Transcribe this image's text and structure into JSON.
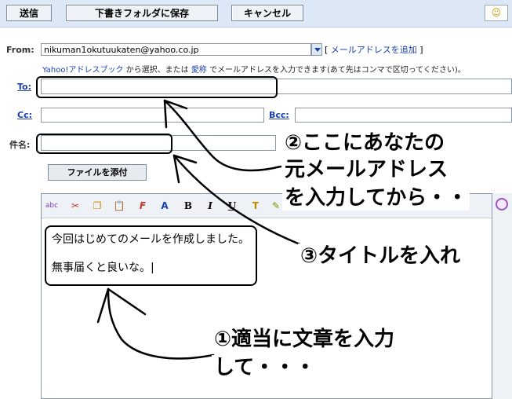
{
  "toolbar": {
    "send_label": "送信",
    "draft_label": "下書きフォルダに保存",
    "cancel_label": "キャンセル"
  },
  "from": {
    "label": "From:",
    "value": "nikuman1okutuukaten@yahoo.co.jp",
    "add_prefix": "[ ",
    "add_link": "メールアドレスを追加",
    "add_suffix": " ]"
  },
  "help": {
    "part1": "Yahoo!アドレスブック",
    "part2": " から選択、または ",
    "part3": "愛称",
    "part4": " でメールアドレスを入力できます(あて先はコンマで区切ってください)。"
  },
  "fields": {
    "to_label": "To:",
    "cc_label": "Cc:",
    "bcc_label": "Bcc:",
    "subject_label": "件名:",
    "to_value": "",
    "cc_value": "",
    "bcc_value": "",
    "subject_value": ""
  },
  "attach_label": "ファイルを添付",
  "editor": {
    "line1": "今回はじめてのメールを作成しました。",
    "line2": "無事届くと良いな。|"
  },
  "annotations": {
    "a2_line1": "②ここにあなたの",
    "a2_line2": "元メールアドレス",
    "a2_line3": "を入力してから・・",
    "a3": "③タイトルを入れ",
    "a1_line1": "①適当に文章を入力",
    "a1_line2": "して・・・"
  },
  "editor_tools": {
    "spell": "abc",
    "cut": "✂",
    "copy": "❐",
    "paste": "📋",
    "font": "F",
    "size": "A",
    "bold": "B",
    "italic": "I",
    "underline": "U",
    "color": "T",
    "highlight": "✎"
  }
}
